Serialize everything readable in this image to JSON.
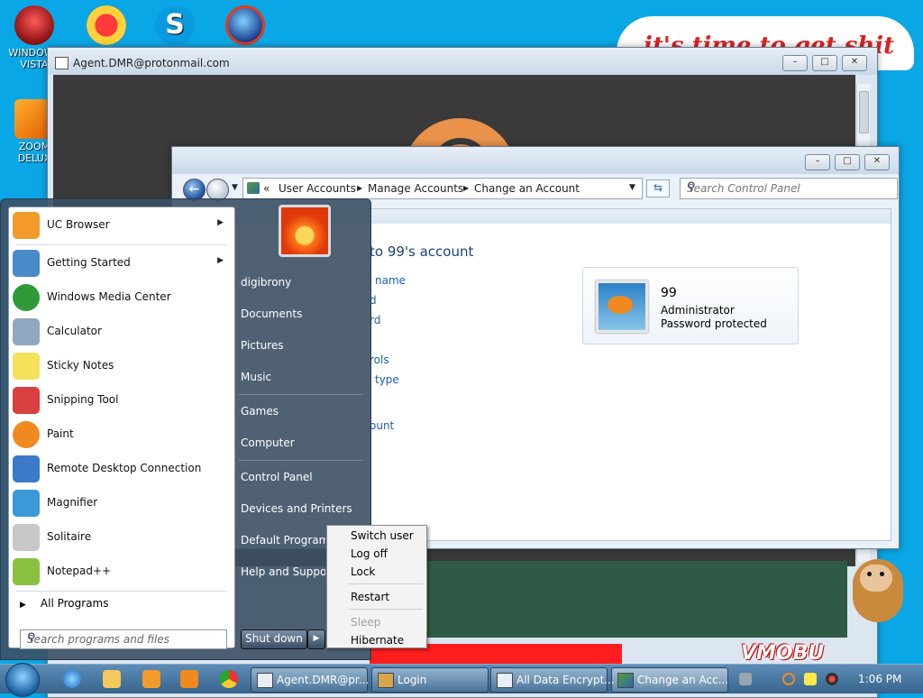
{
  "desktop": {
    "icons": [
      {
        "label": "WINDOWS VISTA"
      },
      {
        "label": ""
      },
      {
        "label": ""
      },
      {
        "label": ""
      },
      {
        "label": "ZOOM DELUX"
      }
    ],
    "bubble_text": "it's time to get shit",
    "corner_text": "VMOBU"
  },
  "back_window": {
    "title": "Agent.DMR@protonmail.com"
  },
  "cp_window": {
    "breadcrumb": [
      "«",
      "User Accounts",
      "Manage Accounts",
      "Change an Account"
    ],
    "search_placeholder": "Search Control Panel",
    "heading": "to 99's account",
    "links": [
      "name",
      "d",
      "rd",
      "rols",
      "type",
      "ount"
    ],
    "account": {
      "name": "99",
      "role": "Administrator",
      "status": "Password protected"
    }
  },
  "start_menu": {
    "programs": [
      {
        "label": "UC Browser",
        "submenu": true,
        "color": "#f29b2b"
      },
      {
        "label": "Getting Started",
        "submenu": true,
        "color": "#4a8ac8"
      },
      {
        "label": "Windows Media Center",
        "submenu": false,
        "color": "#2e9a3a"
      },
      {
        "label": "Calculator",
        "submenu": false,
        "color": "#8fa8c0"
      },
      {
        "label": "Sticky Notes",
        "submenu": false,
        "color": "#f6e15a"
      },
      {
        "label": "Snipping Tool",
        "submenu": false,
        "color": "#d94040"
      },
      {
        "label": "Paint",
        "submenu": false,
        "color": "#f08a20"
      },
      {
        "label": "Remote Desktop Connection",
        "submenu": false,
        "color": "#3a7ac8"
      },
      {
        "label": "Magnifier",
        "submenu": false,
        "color": "#3a9ad8"
      },
      {
        "label": "Solitaire",
        "submenu": false,
        "color": "#c8c8c8"
      },
      {
        "label": "Notepad++",
        "submenu": false,
        "color": "#8ac040"
      }
    ],
    "arrow_glyph": "▶",
    "all_programs": "All Programs",
    "search_placeholder": "Search programs and files",
    "right_items": [
      "digibrony",
      "Documents",
      "Pictures",
      "Music",
      "Games",
      "Computer",
      "Control Panel",
      "Devices and Printers",
      "Default Programs",
      "Help and Support"
    ],
    "shutdown_label": "Shut down"
  },
  "power_menu": {
    "items": [
      "Switch user",
      "Log off",
      "Lock",
      "Restart",
      "Sleep",
      "Hibernate"
    ]
  },
  "taskbar": {
    "buttons": [
      {
        "label": "Agent.DMR@pr..."
      },
      {
        "label": "Login"
      },
      {
        "label": "All Data Encrypt..."
      },
      {
        "label": "Change an Acc..."
      }
    ],
    "clock": "1:06 PM"
  }
}
